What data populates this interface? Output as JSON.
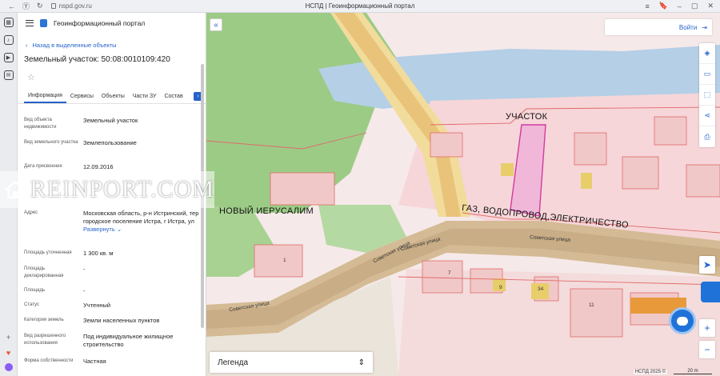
{
  "browser": {
    "url": "nspd.gov.ru",
    "tab_title": "НСПД | Геоинформационный портал"
  },
  "panel": {
    "portal_title": "Геоинформационный портал",
    "back_label": "Назад в выделенные объекты",
    "object_title": "Земельный участок: 50:08:0010109:420",
    "tabs": [
      "Информация",
      "Сервисы",
      "Объекты",
      "Части ЗУ",
      "Состав"
    ],
    "properties": [
      {
        "key": "Вид объекта недвижимости",
        "value": "Земельный участок"
      },
      {
        "key": "Вид земельного участка",
        "value": "Землепользование"
      },
      {
        "key": "Дата присвоения",
        "value": "12.09.2016"
      },
      {
        "key": "Адрес",
        "value": "Московская область, р-н Истринский, тер городское поселение Истра, г Истра, ул"
      },
      {
        "key": "Площадь уточненная",
        "value": "1 300 кв. м"
      },
      {
        "key": "Площадь декларированная",
        "value": "-"
      },
      {
        "key": "Площадь",
        "value": "-"
      },
      {
        "key": "Статус",
        "value": "Учтенный"
      },
      {
        "key": "Категория земель",
        "value": "Земли населенных пунктов"
      },
      {
        "key": "Вид разрешенного использования",
        "value": "Под индивидуальное жилищное строительство"
      },
      {
        "key": "Форма собственности",
        "value": "Частная"
      }
    ],
    "expand_label": "Развернуть"
  },
  "map": {
    "login_label": "Войти",
    "legend_label": "Легенда",
    "copyright": "НСПД 2025 ©",
    "scale": "20 m",
    "labels": {
      "plot": "УЧАСТОК",
      "district": "НОВЫЙ ИЕРУСАЛИМ",
      "utilities": "ГАЗ, ВОДОПРОВОД,ЭЛЕКТРИЧЕСТВО"
    },
    "streets": [
      "Советская улица",
      "Советская улица",
      "Советская улица",
      "Советская улица"
    ],
    "parcel_numbers": [
      "1",
      "7",
      "9",
      "34",
      "11"
    ]
  },
  "watermark": "REINPORT.COM",
  "colors": {
    "accent": "#2563c9",
    "plot_fill": "#f0b7d9",
    "plot_border": "#d13aa0",
    "road": "#d9c39c",
    "green": "#8fc27a",
    "water": "#a9c9e8"
  }
}
